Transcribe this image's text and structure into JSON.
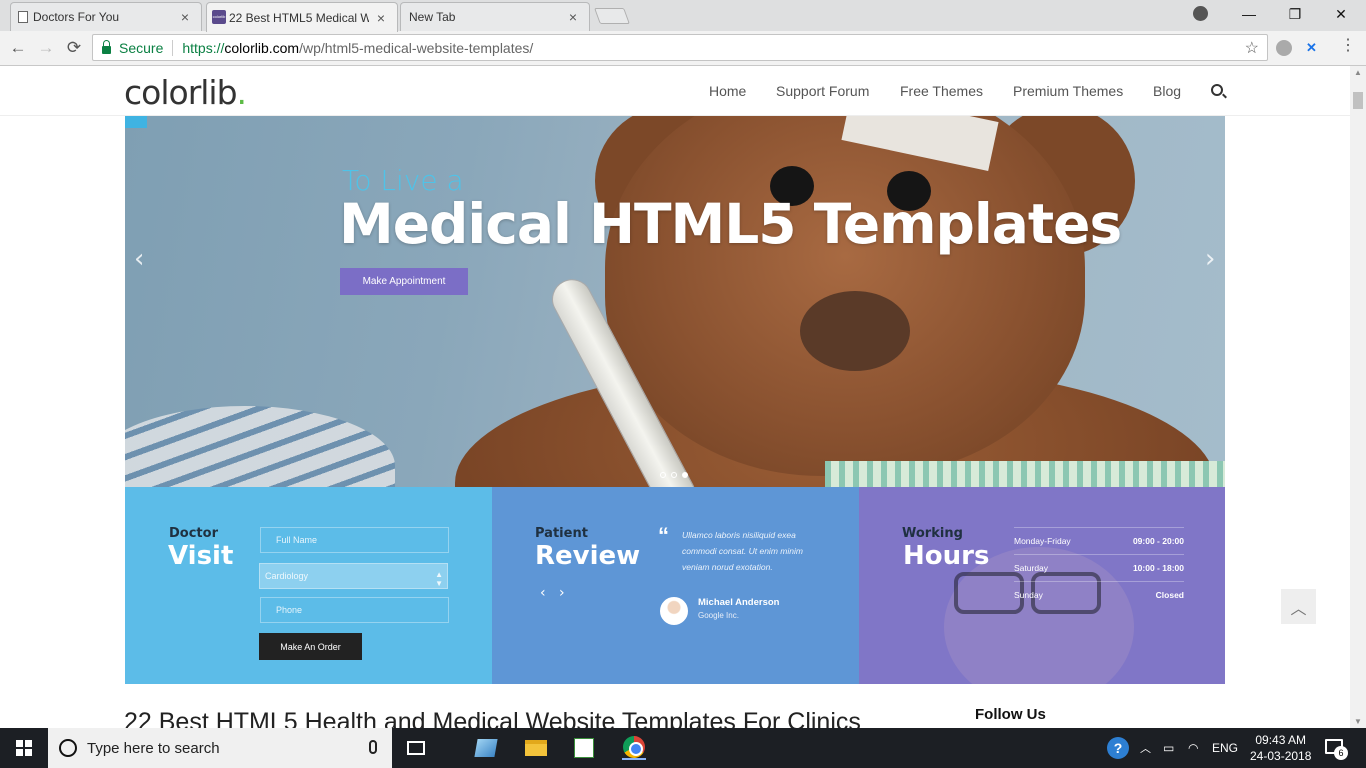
{
  "browser": {
    "tabs": [
      {
        "title": "Doctors For You",
        "close": "×"
      },
      {
        "title": "22 Best HTML5 Medical W",
        "close": "×",
        "favicon_text": "colorlib"
      },
      {
        "title": "New Tab",
        "close": "×"
      }
    ],
    "window_controls": {
      "minimize": "—",
      "maximize": "❐",
      "close": "✕"
    },
    "nav": {
      "back": "←",
      "forward": "→",
      "reload": "⟳"
    },
    "security_label": "Secure",
    "url": {
      "scheme": "https://",
      "host": "colorlib.com",
      "path": "/wp/html5-medical-website-templates/"
    },
    "star": "☆"
  },
  "site": {
    "logo": "colorlib",
    "logo_dot": ".",
    "menu": [
      "Home",
      "Support Forum",
      "Free Themes",
      "Premium Themes",
      "Blog"
    ]
  },
  "hero": {
    "pretitle": "To Live a",
    "title": "Medical HTML5 Templates",
    "button": "Make Appointment",
    "prev": "‹",
    "next": "›",
    "slide_count": 3,
    "active_slide": 1
  },
  "panels": {
    "visit": {
      "small": "Doctor",
      "big": "Visit",
      "name_placeholder": "Full Name",
      "department": "Cardiology",
      "phone_placeholder": "Phone",
      "button": "Make An Order"
    },
    "review": {
      "small": "Patient",
      "big": "Review",
      "quote_mark": "“",
      "quote": "Ullamco laboris nisiliquid exea commodi consat. Ut enim minim veniam norud exotation.",
      "prev": "‹",
      "next": "›",
      "author": "Michael Anderson",
      "company": "Google Inc."
    },
    "hours": {
      "small": "Working",
      "big": "Hours",
      "rows": [
        {
          "day": "Monday-Friday",
          "time": "09:00 - 20:00"
        },
        {
          "day": "Saturday",
          "time": "10:00 - 18:00"
        },
        {
          "day": "Sunday",
          "time": "Closed"
        }
      ]
    }
  },
  "article": {
    "title": "22 Best HTML5 Health and Medical Website Templates For Clinics",
    "sidebar_heading": "Follow Us"
  },
  "back_to_top": "︿",
  "taskbar": {
    "search_placeholder": "Type here to search",
    "language": "ENG",
    "time": "09:43 AM",
    "date": "24-03-2018",
    "notification_count": "6",
    "help": "?"
  },
  "colors": {
    "accent_purple": "#7b6ec6",
    "panel_visit": "#5cbce8",
    "panel_review": "#5e96d6",
    "panel_hours": "#8076c7",
    "secure_green": "#0b8043",
    "logo_dot_green": "#5dbb46"
  }
}
